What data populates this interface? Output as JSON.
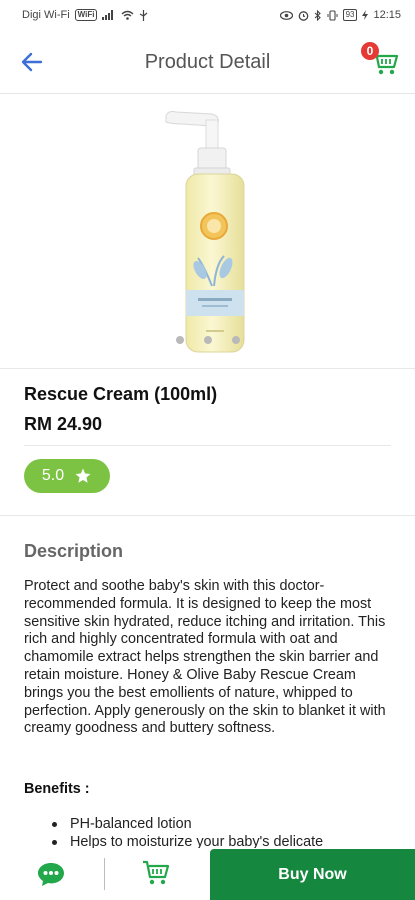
{
  "status_bar": {
    "carrier": "Digi Wi-Fi",
    "carrier_tag": "WiFi",
    "battery": "93",
    "time": "12:15"
  },
  "header": {
    "title": "Product Detail",
    "cart_count": "0"
  },
  "product": {
    "name": "Rescue Cream (100ml)",
    "price": "RM 24.90",
    "rating": "5.0",
    "image_count": 3
  },
  "description": {
    "heading": "Description",
    "text": "Protect and soothe baby's skin with this doctor-recommended formula. It is designed to keep the most sensitive skin hydrated, reduce itching and irritation. This rich and highly concentrated formula with oat and chamomile extract helps strengthen the skin barrier and retain moisture. Honey & Olive Baby Rescue Cream brings you the best emollients of nature, whipped to perfection. Apply generously on the skin to blanket it with creamy goodness and buttery softness."
  },
  "benefits": {
    "heading": "Benefits :",
    "items": [
      "PH-balanced lotion",
      "Helps to moisturize your baby's delicate"
    ]
  },
  "bottom_bar": {
    "buy_label": "Buy Now"
  },
  "colors": {
    "accent_green": "#15873f",
    "rating_green": "#7cc243",
    "back_arrow_blue": "#3d6fd6",
    "badge_red": "#e53935"
  }
}
